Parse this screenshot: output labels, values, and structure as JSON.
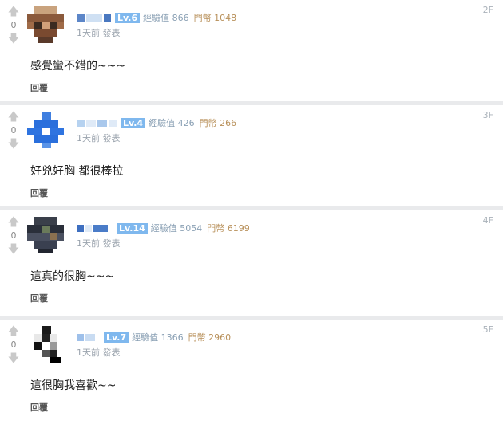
{
  "comments": [
    {
      "floor": "2F",
      "votes": "0",
      "level": "Lv.6",
      "exp": "經驗值 866",
      "coins": "門幣 1048",
      "time": "1天前 發表",
      "text": "感覺蠻不錯的~~~",
      "reply": "回覆"
    },
    {
      "floor": "3F",
      "votes": "0",
      "level": "Lv.4",
      "exp": "經驗值 426",
      "coins": "門幣 266",
      "time": "1天前 發表",
      "text": "好兇好胸 都很棒拉",
      "reply": "回覆"
    },
    {
      "floor": "4F",
      "votes": "0",
      "level": "Lv.14",
      "exp": "經驗值 5054",
      "coins": "門幣 6199",
      "time": "1天前 發表",
      "text": "這真的很胸~~~",
      "reply": "回覆"
    },
    {
      "floor": "5F",
      "votes": "0",
      "level": "Lv.7",
      "exp": "經驗值 1366",
      "coins": "門幣 2960",
      "time": "1天前 發表",
      "text": "這很胸我喜歡~~",
      "reply": "回覆"
    }
  ],
  "icons": {
    "upvote": "arrow-up-icon",
    "downvote": "arrow-down-icon"
  },
  "colors": {
    "level_badge": "#7fb8ee",
    "exp": "#8aa0b4",
    "coins": "#b8905a",
    "separator": "#e9eaec"
  }
}
